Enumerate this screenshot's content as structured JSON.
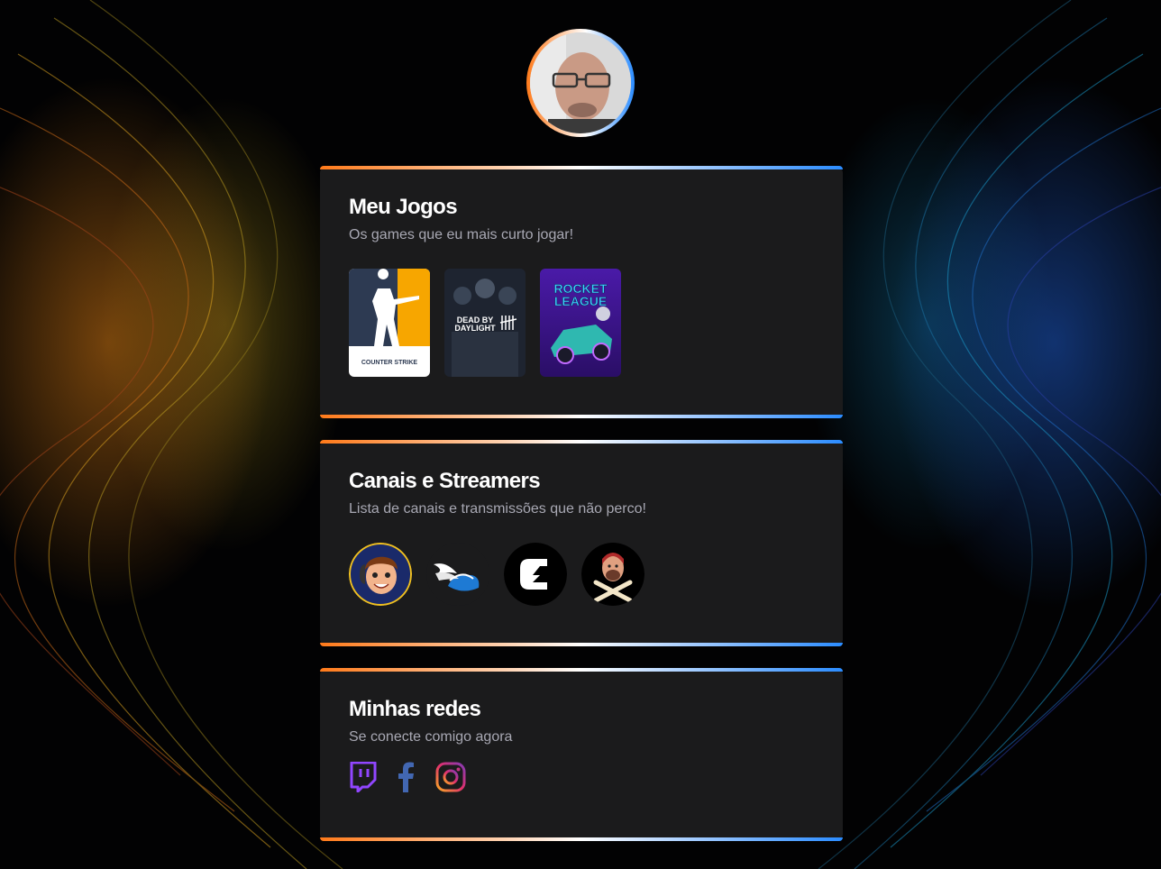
{
  "profile": {
    "avatar_alt": "Foto de perfil"
  },
  "games_section": {
    "title": "Meu Jogos",
    "subtitle": "Os games que eu mais curto jogar!",
    "games": [
      {
        "name": "COUNTER STRIKE",
        "icon": "counter-strike-cover"
      },
      {
        "name": "DEAD BY DAYLIGHT",
        "icon": "dead-by-daylight-cover"
      },
      {
        "name": "ROCKET LEAGUE",
        "icon": "rocket-league-cover"
      }
    ]
  },
  "streamers_section": {
    "title": "Canais e Streamers",
    "subtitle": "Lista de canais e transmissões que não perco!",
    "streamers": [
      {
        "icon": "streamer-cartoon-avatar"
      },
      {
        "icon": "winged-shoe-logo"
      },
      {
        "icon": "lightning-c-logo"
      },
      {
        "icon": "skull-crossbones-avatar"
      }
    ]
  },
  "social_section": {
    "title": "Minhas redes",
    "subtitle": "Se conecte comigo agora",
    "links": [
      {
        "icon": "twitch-icon",
        "color": "#9146ff"
      },
      {
        "icon": "facebook-icon",
        "color": "#4267b2"
      },
      {
        "icon": "instagram-icon",
        "color": "#e1306c"
      }
    ]
  },
  "colors": {
    "gradient_start": "#ff7a1a",
    "gradient_mid": "#ffffff",
    "gradient_end": "#2b8cff",
    "card_bg": "#1b1b1c",
    "text_muted": "#a8a8b3"
  }
}
